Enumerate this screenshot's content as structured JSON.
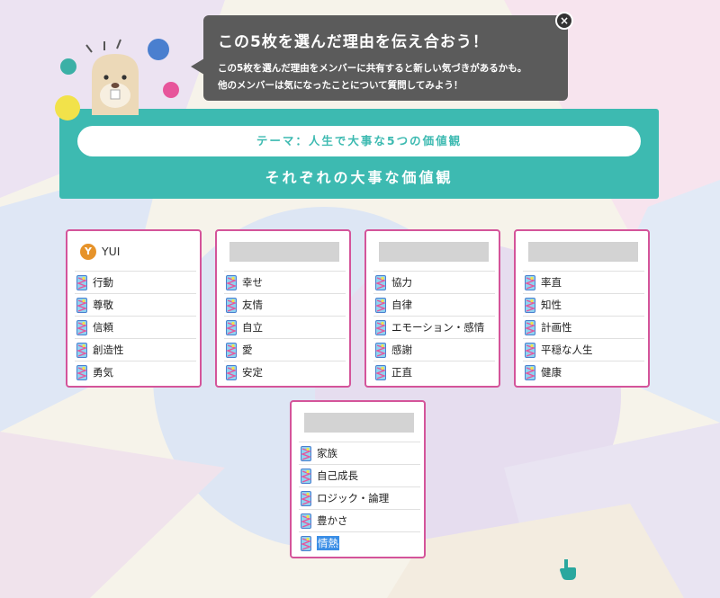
{
  "bubble": {
    "title": "この5枚を選んだ理由を伝え合おう！",
    "line1": "この5枚を選んだ理由をメンバーに共有すると新しい気づきがあるかも。",
    "line2": "他のメンバーは気になったことについて質問してみよう！",
    "close": "×"
  },
  "panel": {
    "theme": "テーマ：人生で大事な5つの価値観",
    "subtitle": "それぞれの大事な価値観"
  },
  "members": [
    {
      "avatar_letter": "Y",
      "name": "YUI",
      "values": [
        "行動",
        "尊敬",
        "信頼",
        "創造性",
        "勇気"
      ]
    },
    {
      "values": [
        "幸せ",
        "友情",
        "自立",
        "愛",
        "安定"
      ]
    },
    {
      "values": [
        "協力",
        "自律",
        "エモーション・感情",
        "感謝",
        "正直"
      ]
    },
    {
      "values": [
        "率直",
        "知性",
        "計画性",
        "平穏な人生",
        "健康"
      ]
    },
    {
      "values": [
        "家族",
        "自己成長",
        "ロジック・論理",
        "豊かさ",
        "情熱"
      ]
    }
  ],
  "selected_value": "情熱",
  "colors": {
    "accent": "#3dbab1",
    "card_border": "#d4549a",
    "avatar": "#e6932a",
    "bubble": "#5b5b5b"
  }
}
